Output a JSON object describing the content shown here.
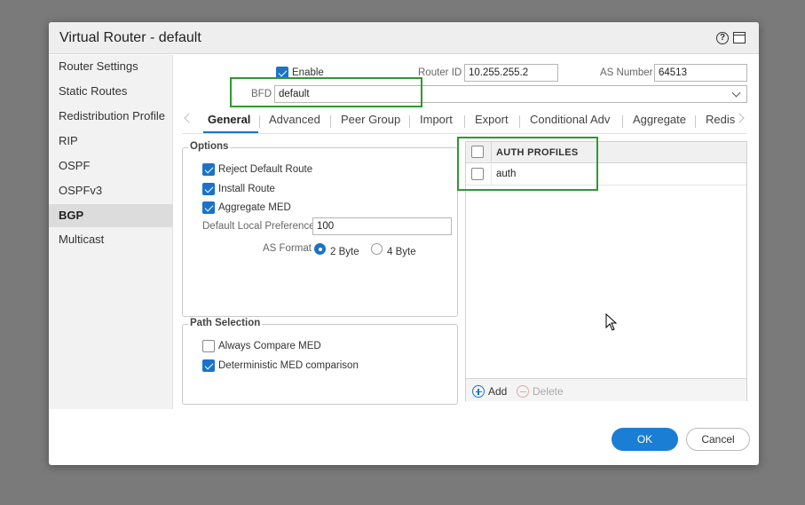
{
  "dialog": {
    "title": "Virtual Router - default",
    "help_icon": "help-circle-icon",
    "maximize_icon": "maximize-window-icon"
  },
  "sidebar": {
    "items": [
      {
        "label": "Router Settings"
      },
      {
        "label": "Static Routes"
      },
      {
        "label": "Redistribution Profile"
      },
      {
        "label": "RIP"
      },
      {
        "label": "OSPF"
      },
      {
        "label": "OSPFv3"
      },
      {
        "label": "BGP",
        "active": true
      },
      {
        "label": "Multicast"
      }
    ]
  },
  "top": {
    "enable_label": "Enable",
    "enable_checked": true,
    "router_id_label": "Router ID",
    "router_id_value": "10.255.255.2",
    "as_number_label": "AS Number",
    "as_number_value": "64513",
    "bfd_label": "BFD",
    "bfd_value": "default"
  },
  "tabs": [
    {
      "label": "General",
      "active": true
    },
    {
      "label": "Advanced"
    },
    {
      "label": "Peer Group"
    },
    {
      "label": "Import"
    },
    {
      "label": "Export"
    },
    {
      "label": "Conditional Adv"
    },
    {
      "label": "Aggregate"
    },
    {
      "label": "Redis"
    }
  ],
  "options": {
    "title": "Options",
    "reject_default_route": {
      "label": "Reject Default Route",
      "checked": true
    },
    "install_route": {
      "label": "Install Route",
      "checked": true
    },
    "aggregate_med": {
      "label": "Aggregate MED",
      "checked": true
    },
    "default_local_pref_label": "Default Local Preference",
    "default_local_pref_value": "100",
    "as_format_label": "AS Format",
    "as_format_2byte": "2 Byte",
    "as_format_4byte": "4 Byte",
    "as_format_selected": "2 Byte"
  },
  "path_selection": {
    "title": "Path Selection",
    "always_compare_med": {
      "label": "Always Compare MED",
      "checked": false
    },
    "deterministic_med": {
      "label": "Deterministic MED comparison",
      "checked": true
    }
  },
  "auth_profiles": {
    "header": "AUTH PROFILES",
    "rows": [
      {
        "name": "auth"
      }
    ],
    "add_label": "Add",
    "delete_label": "Delete"
  },
  "footer": {
    "ok_label": "OK",
    "cancel_label": "Cancel"
  },
  "colors": {
    "accent": "#1a73c8",
    "highlight": "#2e9a2e",
    "backdrop": "#7a7a7a"
  }
}
